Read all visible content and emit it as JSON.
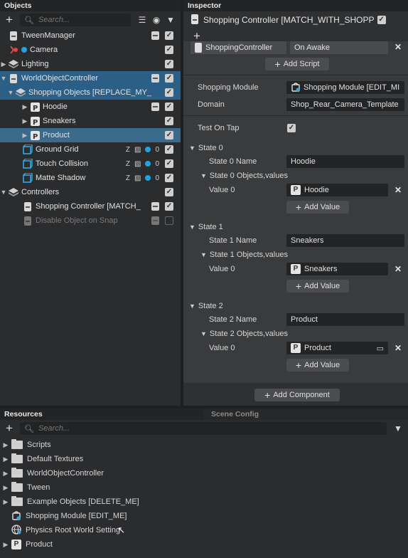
{
  "objects": {
    "title": "Objects",
    "search_placeholder": "Search...",
    "items": [
      {
        "label": "TweenManager"
      },
      {
        "label": "Camera"
      },
      {
        "label": "Lighting"
      },
      {
        "label": "WorldObjectController"
      },
      {
        "label": "Shopping Objects [REPLACE_MY_"
      },
      {
        "label": "Hoodie"
      },
      {
        "label": "Sneakers"
      },
      {
        "label": "Product"
      },
      {
        "label": "Ground Grid",
        "count": "0"
      },
      {
        "label": "Touch Collision",
        "count": "0"
      },
      {
        "label": "Matte Shadow",
        "count": "0"
      },
      {
        "label": "Controllers"
      },
      {
        "label": "Shopping Controller [MATCH_"
      },
      {
        "label": "Disable Object on Snap"
      }
    ]
  },
  "inspector": {
    "title": "Inspector",
    "header": "Shopping Controller [MATCH_WITH_SHOPP",
    "script_name": "ShoppingController",
    "trigger": "On Awake",
    "add_script": "Add Script",
    "shopping_module_label": "Shopping Module",
    "shopping_module_value": "Shopping Module [EDIT_MI",
    "domain_label": "Domain",
    "domain_value": "Shop_Rear_Camera_Template",
    "test_on_tap_label": "Test On Tap",
    "states": [
      {
        "title": "State 0",
        "name_label": "State 0 Name",
        "name_value": "Hoodie",
        "objects_label": "State 0 Objects,values",
        "value_label": "Value 0",
        "value": "Hoodie",
        "add_value": "Add Value"
      },
      {
        "title": "State 1",
        "name_label": "State 1 Name",
        "name_value": "Sneakers",
        "objects_label": "State 1 Objects,values",
        "value_label": "Value 0",
        "value": "Sneakers",
        "add_value": "Add Value"
      },
      {
        "title": "State 2",
        "name_label": "State 2 Name",
        "name_value": "Product",
        "objects_label": "State 2 Objects,values",
        "value_label": "Value 0",
        "value": "Product",
        "add_value": "Add Value"
      }
    ],
    "add_component": "Add Component"
  },
  "resources": {
    "title": "Resources",
    "tab2": "Scene Config",
    "search_placeholder": "Search...",
    "items": [
      {
        "label": "Scripts"
      },
      {
        "label": "Default Textures"
      },
      {
        "label": "WorldObjectController"
      },
      {
        "label": "Tween"
      },
      {
        "label": "Example Objects [DELETE_ME]"
      },
      {
        "label": "Shopping Module [EDIT_ME]"
      },
      {
        "label": "Physics Root World Setting"
      },
      {
        "label": "Product"
      }
    ]
  }
}
